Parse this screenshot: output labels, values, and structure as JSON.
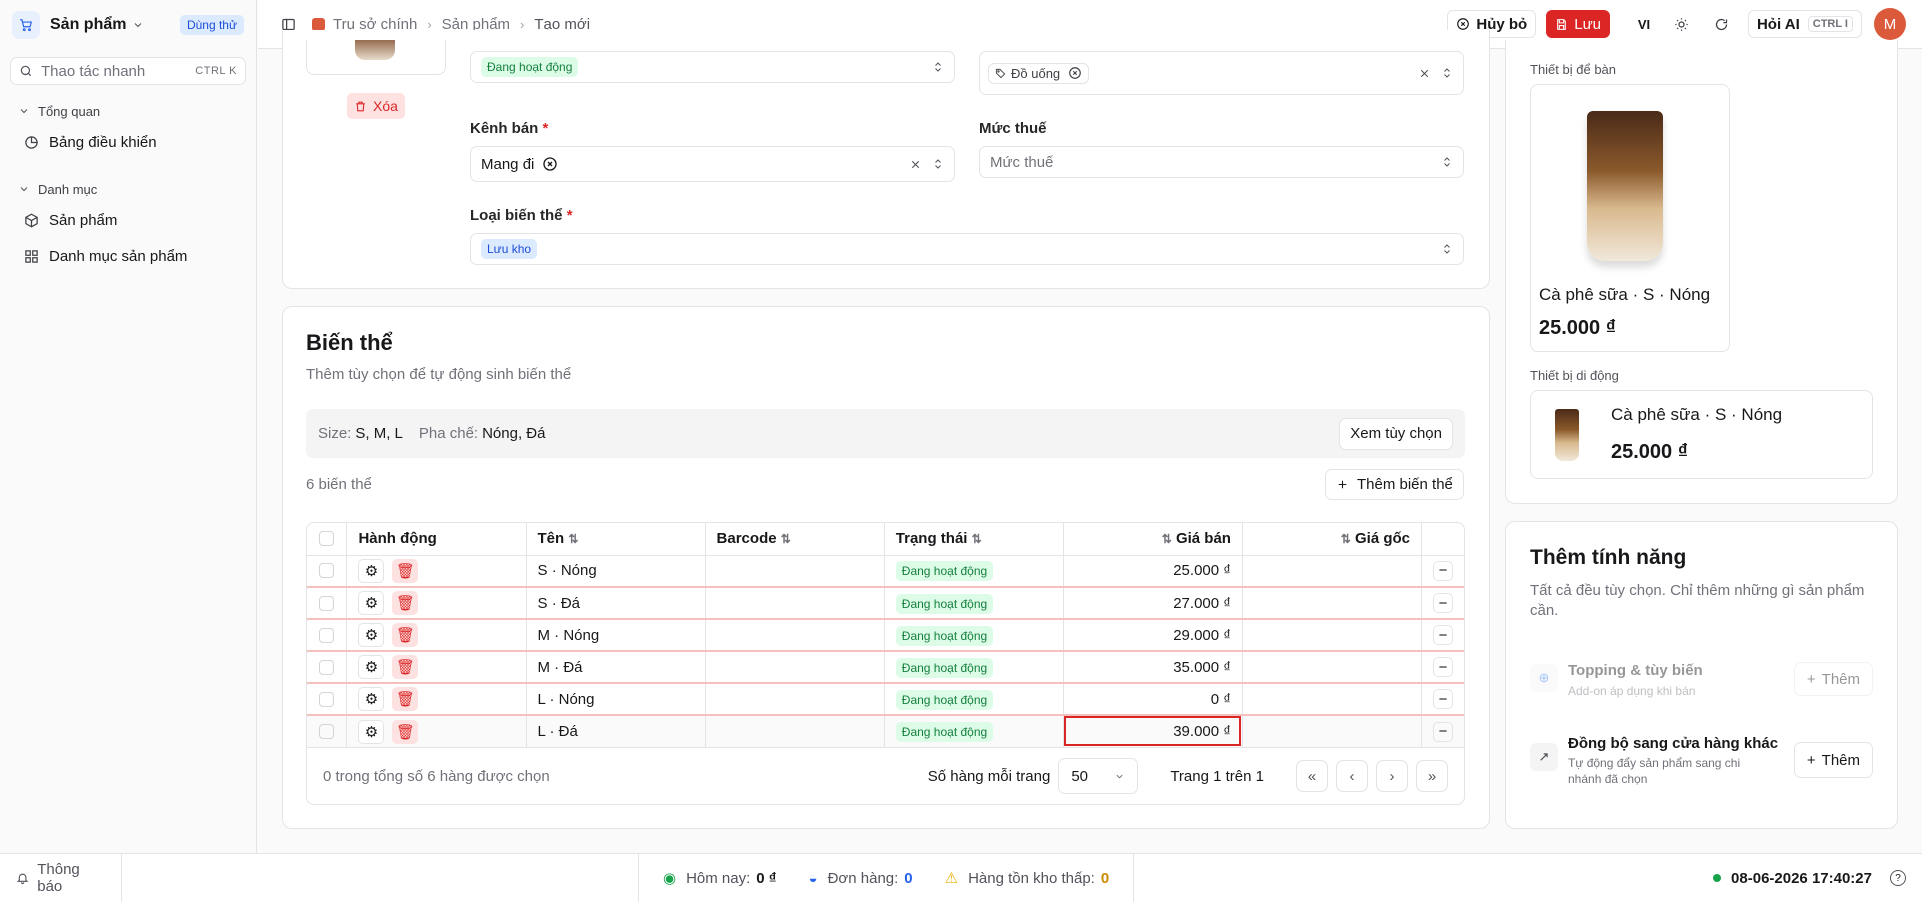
{
  "sidebar": {
    "app_name": "Sản phẩm",
    "trial_badge": "Dùng thử",
    "quick_action": {
      "placeholder": "Thao tác nhanh",
      "shortcut": "CTRL K"
    },
    "sections": [
      {
        "label": "Tổng quan",
        "items": [
          {
            "label": "Bảng điều khiển",
            "icon": "dashboard-icon"
          }
        ]
      },
      {
        "label": "Danh mục",
        "items": [
          {
            "label": "Sản phẩm",
            "icon": "box-icon"
          },
          {
            "label": "Danh mục sản phẩm",
            "icon": "grid-icon"
          }
        ]
      }
    ]
  },
  "topbar": {
    "breadcrumb": [
      "Trụ sở chính",
      "Sản phẩm",
      "Tạo mới"
    ],
    "cancel_label": "Hủy bỏ",
    "save_label": "Lưu",
    "lang": "VI",
    "ask_ai_label": "Hỏi AI",
    "ask_ai_shortcut": "CTRL I",
    "avatar_initial": "M"
  },
  "form": {
    "delete_image_label": "Xóa",
    "status_value": "Đang hoạt động",
    "category_tag": "Đồ uống",
    "channel_label": "Kênh bán",
    "channel_value": "Mang đi",
    "tax_label": "Mức thuế",
    "tax_placeholder": "Mức thuế",
    "variant_type_label": "Loại biến thể",
    "variant_type_value": "Lưu kho"
  },
  "variants": {
    "title": "Biến thể",
    "subtitle": "Thêm tùy chọn để tự động sinh biến thể",
    "opt1_label": "Size:",
    "opt1_value": "S, M, L",
    "opt2_label": "Pha chế:",
    "opt2_value": "Nóng, Đá",
    "view_options_label": "Xem tùy chọn",
    "count_label": "6 biến thể",
    "add_variant_label": "Thêm biến thể",
    "columns": {
      "action": "Hành động",
      "name": "Tên",
      "barcode": "Barcode",
      "status": "Trạng thái",
      "price": "Giá bán",
      "cost": "Giá gốc"
    },
    "rows": [
      {
        "name": "S · Nóng",
        "barcode": "",
        "status": "Đang hoạt động",
        "price": "25.000 ₫",
        "cost": ""
      },
      {
        "name": "S · Đá",
        "barcode": "",
        "status": "Đang hoạt động",
        "price": "27.000 ₫",
        "cost": ""
      },
      {
        "name": "M · Nóng",
        "barcode": "",
        "status": "Đang hoạt động",
        "price": "29.000 ₫",
        "cost": ""
      },
      {
        "name": "M · Đá",
        "barcode": "",
        "status": "Đang hoạt động",
        "price": "35.000 ₫",
        "cost": ""
      },
      {
        "name": "L · Nóng",
        "barcode": "",
        "status": "Đang hoạt động",
        "price": "0 ₫",
        "cost": ""
      },
      {
        "name": "L · Đá",
        "barcode": "",
        "status": "Đang hoạt động",
        "price": "39.000 ₫",
        "cost": ""
      }
    ],
    "selected_info": "0 trong tổng số 6 hàng được chọn",
    "rows_per_page_label": "Số hàng mỗi trang",
    "rows_per_page_value": "50",
    "page_info": "Trang 1 trên 1"
  },
  "preview": {
    "desk_label": "Thiết bị để bàn",
    "mobile_label": "Thiết bị di động",
    "product_name": "Cà phê sữa · S · Nóng",
    "product_price": "25.000 ₫"
  },
  "features": {
    "title": "Thêm tính năng",
    "subtitle": "Tất cả đều tùy chọn. Chỉ thêm những gì sản phẩm cần.",
    "items": [
      {
        "title": "Topping & tùy biến",
        "desc": "Add-on áp dụng khi bán",
        "button": "Thêm",
        "disabled": true
      },
      {
        "title": "Đồng bộ sang cửa hàng khác",
        "desc": "Tự động đẩy sản phẩm sang chi nhánh đã chọn",
        "button": "Thêm",
        "disabled": false
      }
    ]
  },
  "statusbar": {
    "notifications_label": "Thông báo",
    "today_label": "Hôm nay:",
    "today_value": "0 ₫",
    "orders_label": "Đơn hàng:",
    "orders_value": "0",
    "low_stock_label": "Hàng tồn kho thấp:",
    "low_stock_value": "0",
    "datetime": "08-06-2026 17:40:27"
  },
  "colors": {
    "accent": "#dc2626",
    "brand": "#2563eb",
    "success": "#15803d"
  }
}
